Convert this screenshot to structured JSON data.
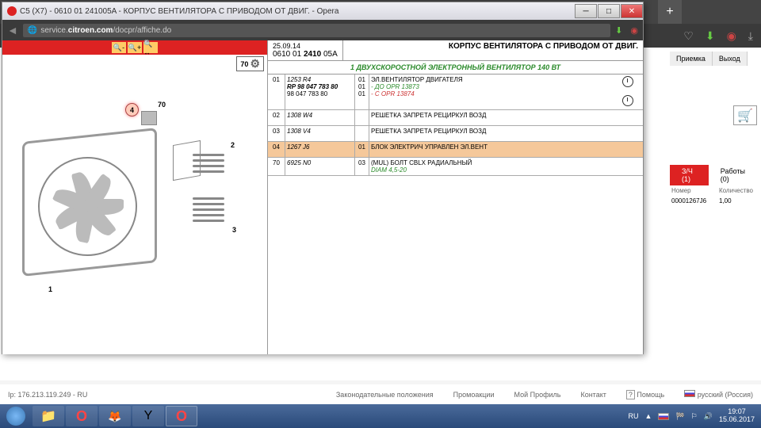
{
  "bg": {
    "add_tab": "+",
    "right_tabs": [
      "Приемка",
      "Выход"
    ],
    "parts_tabs": {
      "active": "З/Ч (1)",
      "inactive": "Работы (0)"
    },
    "parts_table": {
      "h1": "Номер",
      "h2": "Количество",
      "v1": "00001267J6",
      "v2": "1,00"
    }
  },
  "footer": {
    "ip": "Ip: 176.213.119.249 - RU",
    "links": [
      "Законодательные положения",
      "Промоакции",
      "Мой Профиль",
      "Контакт",
      "Помощь",
      "русский (Россия)"
    ]
  },
  "taskbar": {
    "lang": "RU",
    "time": "19:07",
    "date": "15.06.2017"
  },
  "opera": {
    "title": "C5 (X7) - 0610 01 241005A - КОРПУС ВЕНТИЛЯТОРА С ПРИВОДОМ ОТ ДВИГ. - Opera",
    "url_prefix": "service.",
    "url_bold": "citroen.com",
    "url_suffix": "/docpr/affiche.do",
    "item70": "70"
  },
  "header": {
    "date": "25.09.14",
    "code_a": "0610 01 ",
    "code_b": "2410 ",
    "code_c": "05A",
    "title": "КОРПУС ВЕНТИЛЯТОРА С ПРИВОДОМ ОТ ДВИГ.",
    "green": "1 ДВУХСКОРОСТНОЙ ЭЛЕКТРОННЫЙ ВЕНТИЛЯТОР 140 ВТ"
  },
  "rows": [
    {
      "idx": "01",
      "ref": "1253 R4",
      "ref2": "RP 98 047 783 80",
      "ref3": "98 047 783 80",
      "subs": [
        {
          "q": "01",
          "desc": "ЭЛ.ВЕНТИЛЯТОР ДВИГАТЕЛЯ"
        },
        {
          "q": "01",
          "desc": "- ДО OPR 13873",
          "cls": "green-txt"
        },
        {
          "q": "01",
          "desc": "- С OPR 13874",
          "cls": "red-txt"
        }
      ],
      "clock": true
    },
    {
      "idx": "02",
      "ref": "1308 W4",
      "subs": [
        {
          "q": "",
          "desc": "РЕШЕТКА ЗАПРЕТА РЕЦИРКУЛ ВОЗД"
        }
      ]
    },
    {
      "idx": "03",
      "ref": "1308 V4",
      "subs": [
        {
          "q": "",
          "desc": "РЕШЕТКА ЗАПРЕТА РЕЦИРКУЛ ВОЗД"
        }
      ]
    },
    {
      "idx": "04",
      "ref": "1267 J6",
      "subs": [
        {
          "q": "01",
          "desc": "БЛОК ЭЛЕКТРИЧ УПРАВЛЕН ЭЛ.ВЕНТ"
        }
      ],
      "hl": true
    },
    {
      "idx": "70",
      "ref": "6925 N0",
      "subs": [
        {
          "q": "03",
          "desc": "(MUL) БОЛТ CBLX РАДИАЛЬНЫЙ"
        },
        {
          "q": "",
          "desc": "DIAM 4,5-20",
          "cls": "green-txt"
        }
      ]
    }
  ],
  "callouts": {
    "c1": "1",
    "c2": "2",
    "c3": "3",
    "c4": "4",
    "c70": "70"
  }
}
